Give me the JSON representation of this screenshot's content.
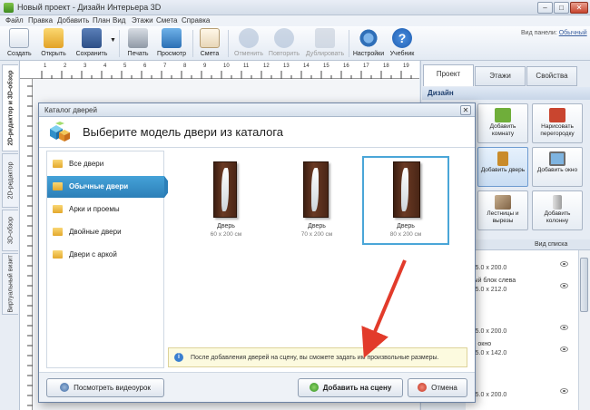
{
  "window": {
    "title": "Новый проект - Дизайн Интерьера 3D",
    "minimize": "–",
    "maximize": "□",
    "close": "✕"
  },
  "menu": [
    "Файл",
    "Правка",
    "Добавить",
    "План",
    "Вид",
    "Этажи",
    "Смета",
    "Справка"
  ],
  "toolbar": {
    "items": [
      {
        "label": "Создать",
        "icon": "new-file-icon",
        "enabled": true
      },
      {
        "label": "Открыть",
        "icon": "open-folder-icon",
        "enabled": true
      },
      {
        "label": "Сохранить",
        "icon": "save-icon",
        "enabled": true
      },
      {
        "label": "Печать",
        "icon": "printer-icon",
        "enabled": true
      },
      {
        "label": "Просмотр",
        "icon": "monitor-icon",
        "enabled": true
      },
      {
        "label": "Смета",
        "icon": "estimate-icon",
        "enabled": true
      },
      {
        "label": "Отменить",
        "icon": "undo-icon",
        "enabled": false
      },
      {
        "label": "Повторить",
        "icon": "redo-icon",
        "enabled": false
      },
      {
        "label": "Дублировать",
        "icon": "duplicate-icon",
        "enabled": false
      },
      {
        "label": "Настройки",
        "icon": "gear-icon",
        "enabled": true
      },
      {
        "label": "Учебник",
        "icon": "help-icon",
        "enabled": true
      }
    ],
    "panel_view_label": "Вид панели:",
    "panel_view_value": "Обычный"
  },
  "left_tabs": [
    "2D-редактор и 3D-обзор",
    "2D-редактор",
    "3D-обзор",
    "Виртуальный визит"
  ],
  "ruler": {
    "numbers": [
      "1",
      "2",
      "3",
      "4",
      "5",
      "6",
      "7",
      "8",
      "9",
      "10",
      "11",
      "12",
      "13",
      "14",
      "15",
      "16",
      "17",
      "18",
      "19"
    ]
  },
  "right_panel": {
    "tabs": [
      "Проект",
      "Этажи",
      "Свойства"
    ],
    "active_tab": "Проект",
    "section_title": "Дизайн",
    "buttons": [
      {
        "label": "Добавить комнату",
        "icon": "add-room-icon",
        "color": "#6fae3a"
      },
      {
        "label": "Нарисовать перегородку",
        "icon": "brick-wall-icon",
        "color": "#c9452f"
      },
      {
        "label": "Добавить дверь",
        "icon": "door-icon",
        "color": "#c98b2a"
      },
      {
        "label": "Добавить окно",
        "icon": "window-icon",
        "color": "#7fb4e0"
      },
      {
        "label": "Лестницы и вырезы",
        "icon": "stairs-icon",
        "color": "#9b7b5a"
      },
      {
        "label": "Добавить колонну",
        "icon": "column-icon",
        "color": "#b8b8b8"
      }
    ],
    "list_title": "ов",
    "list_view": "Вид списка",
    "list": [
      {
        "name": "1",
        "size": "м 15.0 x 200.0"
      },
      {
        "name": "жный блок слева",
        "size": "м 15.0 x 212.0"
      },
      {
        "name": "2",
        "size": "м 15.0 x 200.0"
      },
      {
        "name": "вое окно",
        "size": "м 15.0 x 142.0"
      },
      {
        "name": "3",
        "size": "м 15.0 x 200.0"
      }
    ]
  },
  "dialog": {
    "title": "Каталог дверей",
    "close": "✕",
    "heading": "Выберите модель двери из каталога",
    "categories": [
      {
        "label": "Все двери",
        "active": false
      },
      {
        "label": "Обычные двери",
        "active": true
      },
      {
        "label": "Арки и проемы",
        "active": false
      },
      {
        "label": "Двойные двери",
        "active": false
      },
      {
        "label": "Двери с аркой",
        "active": false
      }
    ],
    "doors": [
      {
        "name": "Дверь",
        "size": "60 x 200 см",
        "selected": false
      },
      {
        "name": "Дверь",
        "size": "70 x 200 см",
        "selected": false
      },
      {
        "name": "Дверь",
        "size": "80 x 200 см",
        "selected": true
      }
    ],
    "info_icon": "i",
    "info": "После добавления дверей на сцену, вы сможете задать им произвольные размеры.",
    "video_button": "Посмотреть видеоурок",
    "add_button": "Добавить на сцену",
    "cancel_button": "Отмена"
  },
  "colors": {
    "accent": "#2c7fb8",
    "selection": "#4aa6d8",
    "arrow": "#e23b2b"
  }
}
